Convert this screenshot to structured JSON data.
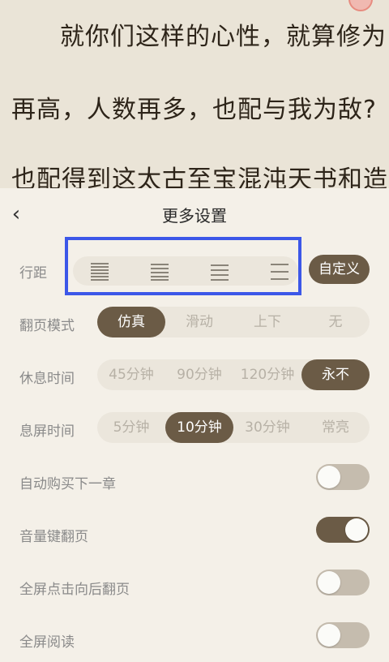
{
  "reader": {
    "lines": [
      "就你们这样的心性，就算修为",
      "再高，人数再多，也配与我为敌?",
      "也配得到这太古至宝混沌天书和造"
    ]
  },
  "settings": {
    "title": "更多设置",
    "back_icon": "chevron-left-icon",
    "line_spacing": {
      "label": "行距",
      "options": [
        "tight-spacing-icon",
        "compact-spacing-icon",
        "normal-spacing-icon",
        "loose-spacing-icon"
      ],
      "custom_label": "自定义"
    },
    "page_mode": {
      "label": "翻页模式",
      "options": [
        "仿真",
        "滑动",
        "上下",
        "无"
      ],
      "selected": "仿真"
    },
    "rest_time": {
      "label": "休息时间",
      "options": [
        "45分钟",
        "90分钟",
        "120分钟",
        "永不"
      ],
      "selected": "永不"
    },
    "screen_off": {
      "label": "息屏时间",
      "options": [
        "5分钟",
        "10分钟",
        "30分钟",
        "常亮"
      ],
      "selected": "10分钟"
    },
    "toggles": [
      {
        "label": "自动购买下一章",
        "on": false
      },
      {
        "label": "音量键翻页",
        "on": true
      },
      {
        "label": "全屏点击向后翻页",
        "on": false
      },
      {
        "label": "全屏阅读",
        "on": false
      }
    ]
  },
  "colors": {
    "accent": "#6b5b46",
    "highlight_box": "#3c57e8"
  }
}
